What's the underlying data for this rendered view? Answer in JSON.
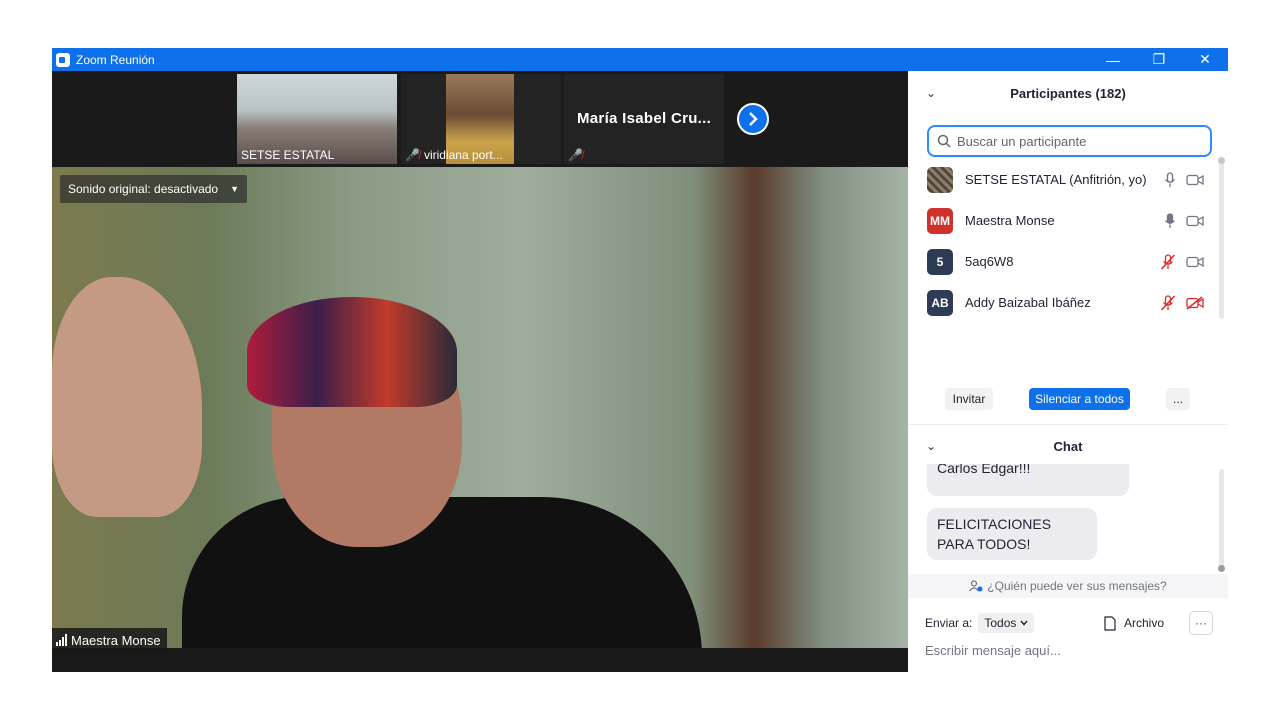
{
  "window": {
    "title": "Zoom Reunión",
    "controls": {
      "minimize": "—",
      "restore": "❐",
      "close": "✕"
    }
  },
  "thumbnails": [
    {
      "name": "SETSE ESTATAL",
      "muted": false
    },
    {
      "name": "viridiana port...",
      "muted": true
    },
    {
      "name": "",
      "display_name": "María Isabel Cru...",
      "muted": true
    }
  ],
  "next_page_icon": "chevron-right-icon",
  "video": {
    "audio_pill": "Sonido original: desactivado",
    "speaker_name": "Maestra Monse"
  },
  "participants": {
    "title": "Participantes (182)",
    "search_placeholder": "Buscar un participante",
    "list": [
      {
        "initials": "",
        "name": "SETSE ESTATAL (Anfitrión, yo)",
        "avatar_color": "#6b6456",
        "mic": "on",
        "video": "on"
      },
      {
        "initials": "MM",
        "name": "Maestra Monse",
        "avatar_color": "#d0312d",
        "mic": "on",
        "video": "on"
      },
      {
        "initials": "5",
        "name": "5aq6W8",
        "avatar_color": "#2e3b55",
        "mic": "muted",
        "video": "on"
      },
      {
        "initials": "AB",
        "name": "Addy Baizabal Ibáñez",
        "avatar_color": "#2e3b55",
        "mic": "muted",
        "video": "off"
      }
    ],
    "buttons": {
      "invite": "Invitar",
      "mute_all": "Silenciar a todos",
      "more": "..."
    }
  },
  "chat": {
    "title": "Chat",
    "messages": [
      {
        "text": "Carlos Edgar!!!"
      },
      {
        "text": "FELICITACIONES PARA TODOS!"
      }
    ],
    "who_can_see": "¿Quién puede ver sus mensajes?",
    "send_to_label": "Enviar a:",
    "send_to_value": "Todos",
    "file_label": "Archivo",
    "more": "···",
    "input_placeholder": "Escribir mensaje aquí..."
  },
  "colors": {
    "zoom_blue": "#0e71eb",
    "mute_red": "#e02828"
  }
}
